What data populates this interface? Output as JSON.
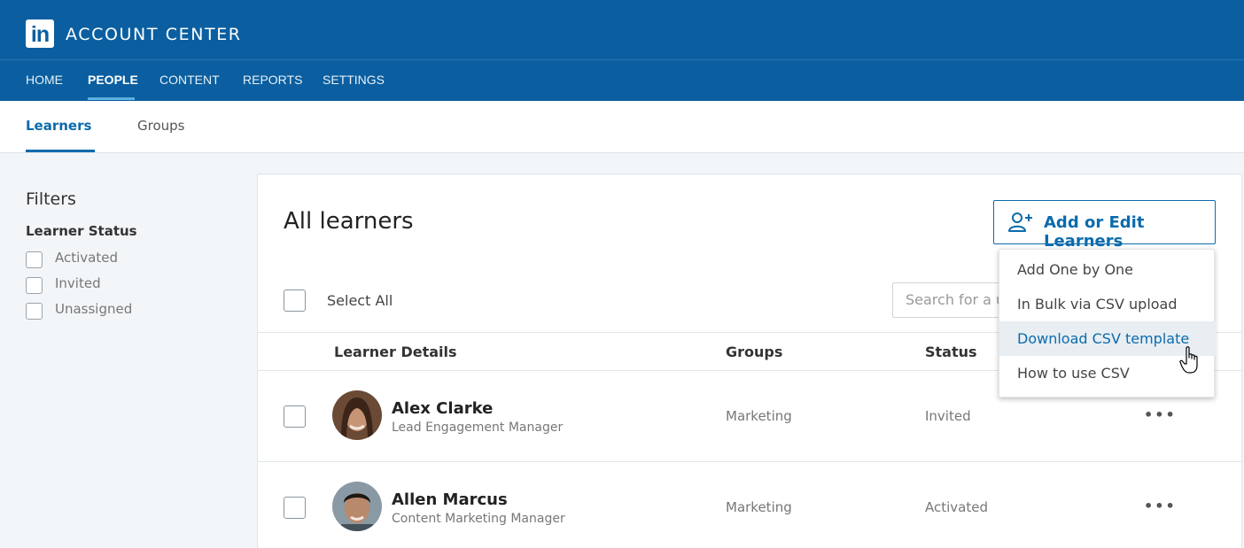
{
  "header": {
    "logo_text": "in",
    "app_title": "ACCOUNT CENTER",
    "brand_color": "#0b5fa0"
  },
  "nav": {
    "items": [
      {
        "label": "HOME",
        "active": false
      },
      {
        "label": "PEOPLE",
        "active": true
      },
      {
        "label": "CONTENT",
        "active": false
      },
      {
        "label": "REPORTS",
        "active": false
      },
      {
        "label": "SETTINGS",
        "active": false
      }
    ]
  },
  "subtabs": [
    {
      "label": "Learners",
      "active": true
    },
    {
      "label": "Groups",
      "active": false
    }
  ],
  "filters": {
    "title": "Filters",
    "group_title": "Learner Status",
    "options": [
      {
        "label": "Activated",
        "checked": false
      },
      {
        "label": "Invited",
        "checked": false
      },
      {
        "label": "Unassigned",
        "checked": false
      }
    ]
  },
  "main": {
    "title": "All learners",
    "add_button_label": "Add or Edit Learners",
    "add_button_icon": "add-person-icon",
    "select_all_label": "Select All",
    "search_placeholder": "Search for a user",
    "columns": [
      "Learner Details",
      "Groups",
      "Status"
    ],
    "rows": [
      {
        "name": "Alex Clarke",
        "title": "Lead Engagement Manager",
        "group": "Marketing",
        "status": "Invited",
        "more": "•••"
      },
      {
        "name": "Allen Marcus",
        "title": "Content Marketing Manager",
        "group": "Marketing",
        "status": "Activated",
        "more": "•••"
      }
    ]
  },
  "dropdown": {
    "items": [
      {
        "label": "Add One by One",
        "hover": false
      },
      {
        "label": "In Bulk via CSV upload",
        "hover": false
      },
      {
        "label": "Download CSV template",
        "hover": true
      },
      {
        "label": "How to use CSV",
        "hover": false
      }
    ]
  },
  "colors": {
    "accent": "#0b6bad",
    "nav_underline": "#5fb0e0",
    "hover_bg": "#e8eef2"
  }
}
